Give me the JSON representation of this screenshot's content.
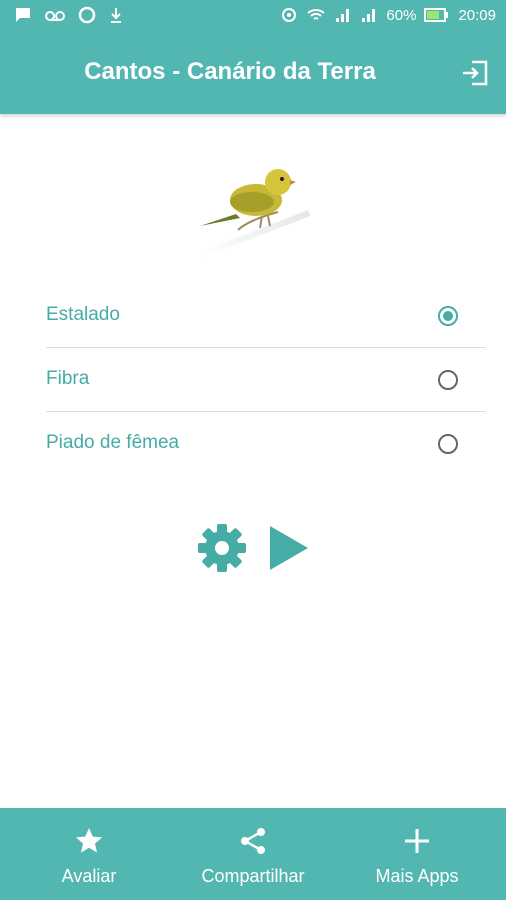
{
  "status_bar": {
    "battery": "60%",
    "time": "20:09",
    "left_icons": [
      "message-icon",
      "voicemail-icon",
      "circle-icon",
      "download-icon"
    ],
    "right_icons": [
      "sync-icon",
      "wifi-icon",
      "signal-icon",
      "signal-2-icon",
      "battery-icon"
    ]
  },
  "app_bar": {
    "title": "Cantos - Canário da Terra",
    "action_icon": "exit-icon"
  },
  "options": [
    {
      "label": "Estalado",
      "selected": true
    },
    {
      "label": "Fibra",
      "selected": false
    },
    {
      "label": "Piado de fêmea",
      "selected": false
    }
  ],
  "controls": {
    "settings_icon": "gear-icon",
    "play_icon": "play-icon"
  },
  "bottom_nav": [
    {
      "label": "Avaliar",
      "icon": "star-icon"
    },
    {
      "label": "Compartilhar",
      "icon": "share-icon"
    },
    {
      "label": "Mais Apps",
      "icon": "plus-icon"
    }
  ],
  "colors": {
    "primary": "#53b7b1",
    "accent_text": "#45aca6"
  }
}
